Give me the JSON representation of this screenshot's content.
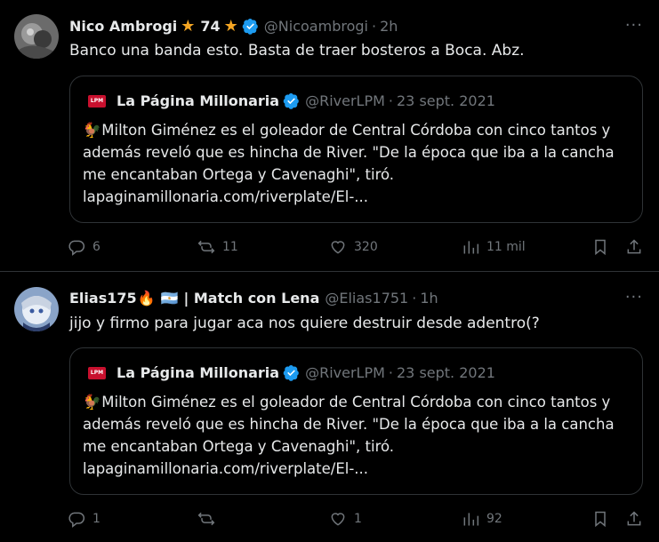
{
  "tweets": [
    {
      "author_name": "Nico Ambrogi",
      "star1": "★",
      "badge_number": "74",
      "star2": "★",
      "handle": "@Nicoambrogi",
      "dot": "·",
      "time": "2h",
      "text": "Banco una banda esto. Basta de traer bosteros a Boca. Abz.",
      "quote": {
        "logo_text": "LPM",
        "name": "La Página Millonaria",
        "handle": "@RiverLPM",
        "dot": "·",
        "date": "23 sept. 2021",
        "emoji": "🐓",
        "text": "Milton Giménez es el goleador de Central Córdoba con cinco tantos y además reveló que es hincha de River. \"De la época que iba a la cancha me encantaban Ortega y Cavenaghi\", tiró. lapaginamillonaria.com/riverplate/El-..."
      },
      "replies": "6",
      "retweets": "11",
      "likes": "320",
      "views": "11 mil"
    },
    {
      "author_name": "Elias175",
      "emoji_fire": "🔥",
      "flag": "🇦🇷",
      "name_suffix": "| Match con Lena",
      "handle": "@Elias1751",
      "dot": "·",
      "time": "1h",
      "text": "jijo y firmo para jugar aca nos quiere destruir desde adentro(?",
      "quote": {
        "logo_text": "LPM",
        "name": "La Página Millonaria",
        "handle": "@RiverLPM",
        "dot": "·",
        "date": "23 sept. 2021",
        "emoji": "🐓",
        "text": "Milton Giménez es el goleador de Central Córdoba con cinco tantos y además reveló que es hincha de River. \"De la época que iba a la cancha me encantaban Ortega y Cavenaghi\", tiró. lapaginamillonaria.com/riverplate/El-..."
      },
      "replies": "1",
      "retweets": "",
      "likes": "1",
      "views": "92"
    }
  ],
  "more_label": "···",
  "colors": {
    "verified": "#1d9bf0",
    "muted": "#71767b",
    "border": "#2f3336"
  }
}
